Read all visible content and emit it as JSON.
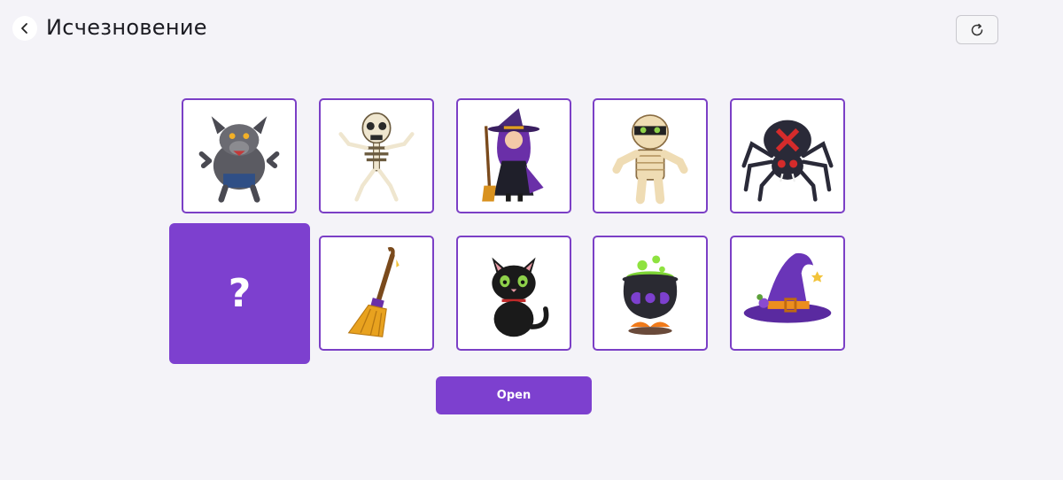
{
  "header": {
    "title": "Исчезновение",
    "back_icon": "chevron-left-icon",
    "reload_icon": "reload-icon"
  },
  "game": {
    "cards": [
      {
        "name": "werewolf",
        "icon": "werewolf-icon"
      },
      {
        "name": "skeleton",
        "icon": "skeleton-icon"
      },
      {
        "name": "witch",
        "icon": "witch-icon"
      },
      {
        "name": "mummy",
        "icon": "mummy-icon"
      },
      {
        "name": "spider",
        "icon": "spider-icon"
      },
      {
        "name": "broom",
        "icon": "broom-icon"
      },
      {
        "name": "black-cat",
        "icon": "black-cat-icon"
      },
      {
        "name": "cauldron",
        "icon": "cauldron-icon"
      },
      {
        "name": "witch-hat",
        "icon": "witch-hat-icon"
      }
    ],
    "hidden_card": {
      "label": "?"
    },
    "open_button": {
      "label": "Open"
    }
  },
  "colors": {
    "accent": "#7d40cf",
    "card_border": "#7b3fc6",
    "background": "#f4f3f8"
  }
}
